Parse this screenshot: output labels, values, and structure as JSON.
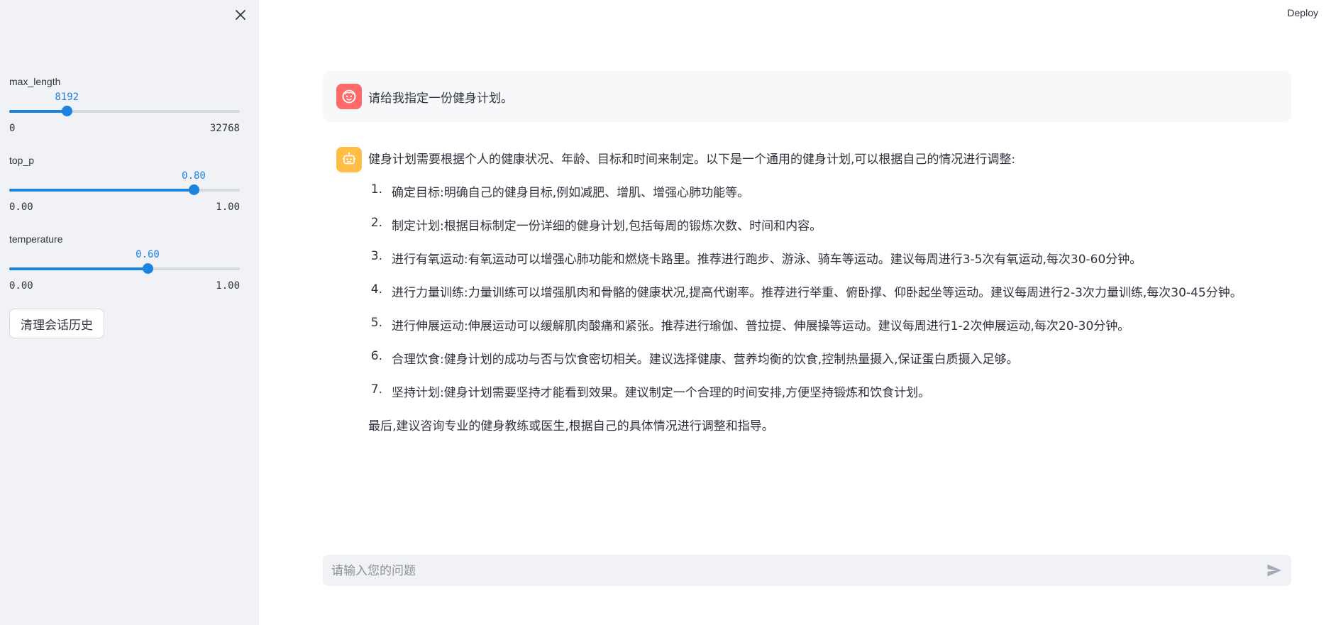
{
  "sidebar": {
    "close_icon": "close-icon",
    "sliders": [
      {
        "label": "max_length",
        "value_text": "8192",
        "value": 8192,
        "min_text": "0",
        "max_text": "32768",
        "min": 0,
        "max": 32768
      },
      {
        "label": "top_p",
        "value_text": "0.80",
        "value": 0.8,
        "min_text": "0.00",
        "max_text": "1.00",
        "min": 0,
        "max": 1
      },
      {
        "label": "temperature",
        "value_text": "0.60",
        "value": 0.6,
        "min_text": "0.00",
        "max_text": "1.00",
        "min": 0,
        "max": 1
      }
    ],
    "clear_button_label": "清理会话历史",
    "accent_color": "#1c83e1"
  },
  "header": {
    "deploy_label": "Deploy"
  },
  "chat": {
    "user_message": "请给我指定一份健身计划。",
    "user_avatar_icon": "user-face-icon",
    "user_avatar_color": "#ff6b6b",
    "bot_avatar_icon": "robot-icon",
    "bot_avatar_color": "#ffbd45",
    "assistant": {
      "intro": "健身计划需要根据个人的健康状况、年龄、目标和时间来制定。以下是一个通用的健身计划,可以根据自己的情况进行调整:",
      "items": [
        {
          "num": "1.",
          "text": "确定目标:明确自己的健身目标,例如减肥、增肌、增强心肺功能等。"
        },
        {
          "num": "2.",
          "text": "制定计划:根据目标制定一份详细的健身计划,包括每周的锻炼次数、时间和内容。"
        },
        {
          "num": "3.",
          "text": "进行有氧运动:有氧运动可以增强心肺功能和燃烧卡路里。推荐进行跑步、游泳、骑车等运动。建议每周进行3-5次有氧运动,每次30-60分钟。"
        },
        {
          "num": "4.",
          "text": "进行力量训练:力量训练可以增强肌肉和骨骼的健康状况,提高代谢率。推荐进行举重、俯卧撑、仰卧起坐等运动。建议每周进行2-3次力量训练,每次30-45分钟。"
        },
        {
          "num": "5.",
          "text": "进行伸展运动:伸展运动可以缓解肌肉酸痛和紧张。推荐进行瑜伽、普拉提、伸展操等运动。建议每周进行1-2次伸展运动,每次20-30分钟。"
        },
        {
          "num": "6.",
          "text": "合理饮食:健身计划的成功与否与饮食密切相关。建议选择健康、营养均衡的饮食,控制热量摄入,保证蛋白质摄入足够。"
        },
        {
          "num": "7.",
          "text": "坚持计划:健身计划需要坚持才能看到效果。建议制定一个合理的时间安排,方便坚持锻炼和饮食计划。"
        }
      ],
      "outro": "最后,建议咨询专业的健身教练或医生,根据自己的具体情况进行调整和指导。"
    }
  },
  "input": {
    "placeholder": "请输入您的问题",
    "value": "",
    "send_icon": "send-icon"
  }
}
